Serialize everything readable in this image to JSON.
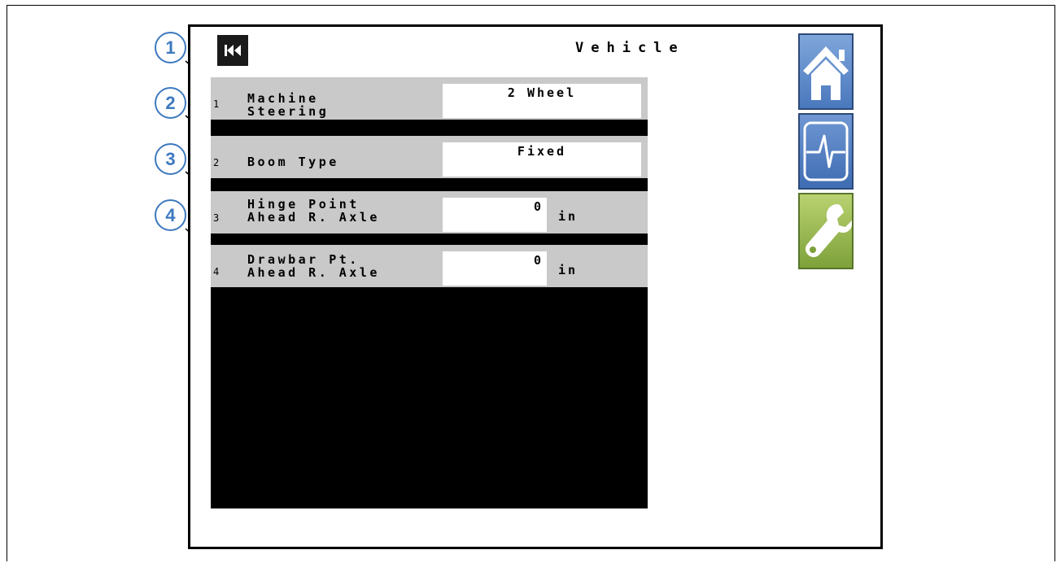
{
  "header": {
    "title": "Vehicle"
  },
  "rows": [
    {
      "index": "1",
      "label": "Machine\nSteering",
      "value": "2 Wheel",
      "unit": ""
    },
    {
      "index": "2",
      "label": "Boom Type",
      "value": "Fixed",
      "unit": ""
    },
    {
      "index": "3",
      "label": "Hinge Point\nAhead R. Axle",
      "value": "0",
      "unit": "in"
    },
    {
      "index": "4",
      "label": "Drawbar Pt.\nAhead R. Axle",
      "value": "0",
      "unit": "in"
    }
  ],
  "callouts": [
    "1",
    "2",
    "3",
    "4"
  ],
  "sidebar": {
    "home": "home-icon",
    "diagnostics": "pulse-icon",
    "settings": "wrench-icon"
  },
  "colors": {
    "row_bg": "#c9c9c9",
    "panel": "#000000",
    "callout": "#3d79bf",
    "home": "#5b87c8",
    "settings": "#94b34a"
  }
}
